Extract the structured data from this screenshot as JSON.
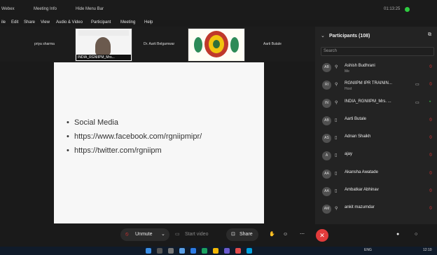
{
  "window": {
    "app_name": "Webex",
    "meeting_info": "Meeting Info",
    "hide_menu": "Hide Menu Bar",
    "timer": "01:13:25"
  },
  "menu": [
    "ile",
    "Edit",
    "Share",
    "View",
    "Audio & Video",
    "Participant",
    "Meeting",
    "Help"
  ],
  "thumbnails": {
    "priya": "priya sharma",
    "video_name": "INDIA_RGNIIPM_Mrs...",
    "aarti_b": "Dr. Aarti Belgamwar",
    "aarti_butale": "Aarti Butale"
  },
  "slide": {
    "items": [
      "Social Media",
      "https://www.facebook.com/rgniipmipr/",
      "https://twitter.com/rgniipm"
    ]
  },
  "participants": {
    "title": "Participants (108)",
    "search_placeholder": "Search",
    "list": [
      {
        "initials": "AB",
        "name": "Ashish Budhrani",
        "sub": "Me",
        "icon": "mic-icon"
      },
      {
        "initials": "RI",
        "name": "RGNIIPM IPR TRAININ...",
        "sub": "Host",
        "icon": "mic-icon"
      },
      {
        "initials": "IN",
        "name": "INDIA_RGNIIPM_Mrs. ...",
        "sub": "",
        "icon": "mic-icon"
      },
      {
        "initials": "AB",
        "name": "Aarti Butale",
        "sub": "",
        "icon": "phone-icon"
      },
      {
        "initials": "AS",
        "name": "Adnan Shaikh",
        "sub": "",
        "icon": "phone-icon"
      },
      {
        "initials": "A",
        "name": "ajay",
        "sub": "",
        "icon": "phone-icon"
      },
      {
        "initials": "AA",
        "name": "Akansha Awatade",
        "sub": "",
        "icon": "phone-icon"
      },
      {
        "initials": "AA",
        "name": "Ambatkar Abhinav",
        "sub": "",
        "icon": "phone-icon"
      },
      {
        "initials": "AM",
        "name": "ankit mazumdar",
        "sub": "",
        "icon": "mic-icon"
      }
    ]
  },
  "toolbar": {
    "unmute": "Unmute",
    "start_video": "Start video",
    "share": "Share"
  },
  "taskbar": {
    "lang": "ENG",
    "time": "12:10"
  },
  "colors": {
    "leave": "#e23b3b",
    "muted": "#e33333",
    "rec": "#2ecc40"
  }
}
